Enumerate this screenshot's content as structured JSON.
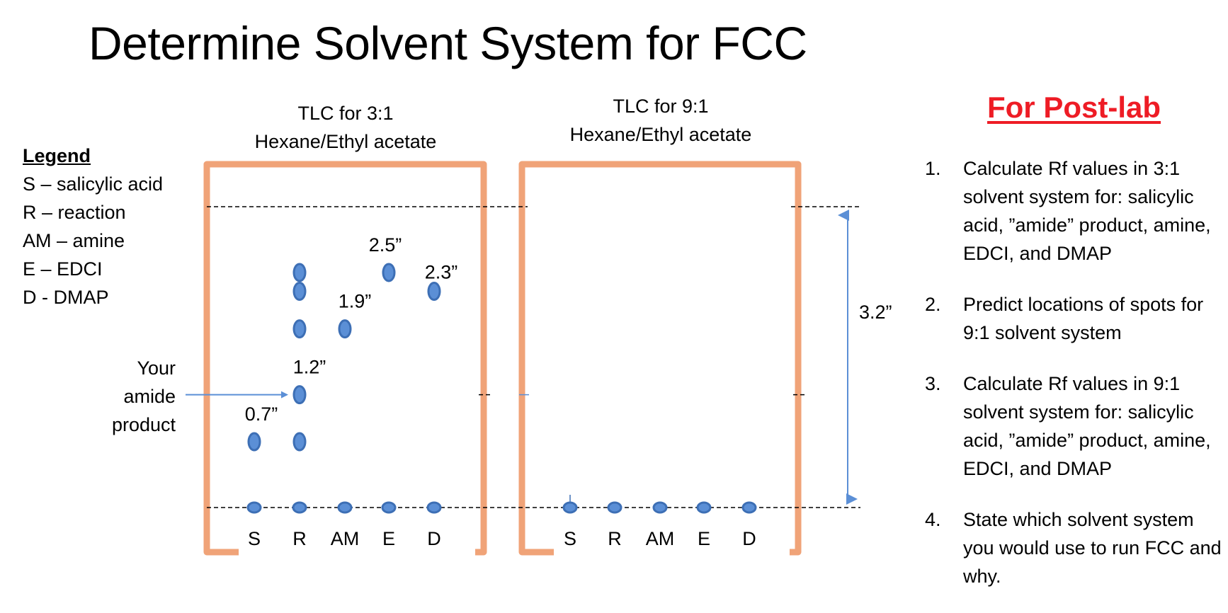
{
  "title": "Determine Solvent System for FCC",
  "legend": {
    "heading": "Legend",
    "items": [
      "S – salicylic acid",
      "R – reaction",
      "AM – amine",
      "E – EDCI",
      "D - DMAP"
    ]
  },
  "amide_callout": {
    "lines": [
      "Your",
      "amide",
      "product"
    ]
  },
  "plates": [
    {
      "title_line1": "TLC for 3:1",
      "title_line2": "Hexane/Ethyl acetate",
      "lanes": [
        "S",
        "R",
        "AM",
        "E",
        "D"
      ],
      "spots": [
        {
          "lane": "S",
          "distance_in": 0.7
        },
        {
          "lane": "R",
          "distance_in": 0.7
        },
        {
          "lane": "R",
          "distance_in": 1.2
        },
        {
          "lane": "R",
          "distance_in": 1.9
        },
        {
          "lane": "R",
          "distance_in": 2.3
        },
        {
          "lane": "R",
          "distance_in": 2.5
        },
        {
          "lane": "AM",
          "distance_in": 1.9
        },
        {
          "lane": "E",
          "distance_in": 2.5
        },
        {
          "lane": "D",
          "distance_in": 2.3
        }
      ],
      "distance_labels": [
        {
          "lane": "S",
          "text": "0.7”",
          "distance_in": 0.7
        },
        {
          "lane": "R",
          "text": "1.2”",
          "distance_in": 1.2
        },
        {
          "lane": "AM",
          "text": "1.9”",
          "distance_in": 1.9
        },
        {
          "lane": "E",
          "text": "2.5”",
          "distance_in": 2.5
        },
        {
          "lane": "D",
          "text": "2.3”",
          "distance_in": 2.3
        }
      ]
    },
    {
      "title_line1": "TLC for 9:1",
      "title_line2": "Hexane/Ethyl acetate",
      "lanes": [
        "S",
        "R",
        "AM",
        "E",
        "D"
      ],
      "spots": [],
      "distance_labels": []
    }
  ],
  "solvent_front": {
    "distance_in": 3.2,
    "label": "3.2”"
  },
  "colors": {
    "plate_frame": "#f0a378",
    "spot_fill": "#5b8fd6",
    "spot_stroke": "#3d6fb5",
    "arrow": "#5b8fd6",
    "postlab_title": "#ee1c25"
  },
  "postlab": {
    "title": "For Post-lab",
    "items": [
      {
        "num": "1.",
        "text": "Calculate Rf values in 3:1 solvent system for: salicylic acid, ”amide” product, amine, EDCI, and DMAP"
      },
      {
        "num": "2.",
        "text": "Predict locations of spots for 9:1 solvent system"
      },
      {
        "num": "3.",
        "text": "Calculate Rf values in 9:1 solvent system for: salicylic acid, ”amide” product, amine, EDCI, and DMAP"
      },
      {
        "num": "4.",
        "text": "State which solvent system you would use to run FCC and why."
      }
    ]
  }
}
